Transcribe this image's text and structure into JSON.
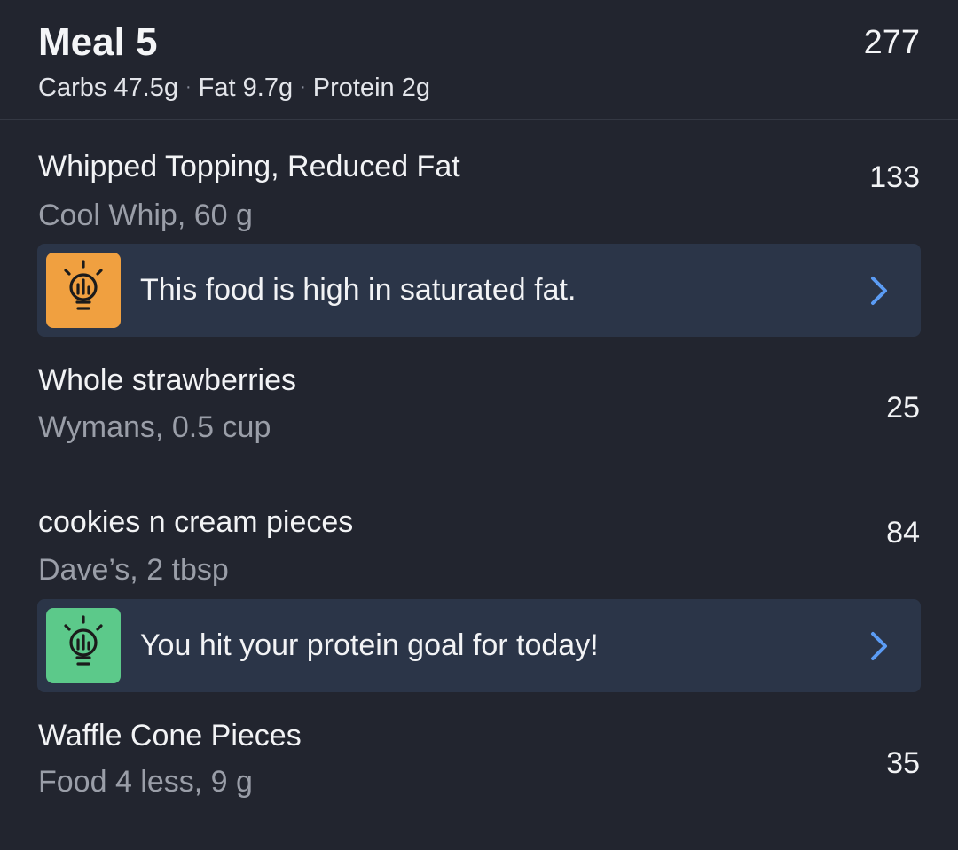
{
  "meal": {
    "title": "Meal 5",
    "calories": "277",
    "macros": {
      "carbs": "Carbs 47.5g",
      "fat": "Fat 9.7g",
      "protein": "Protein 2g",
      "separator": "·"
    }
  },
  "foods": [
    {
      "name": "Whipped Topping, Reduced Fat",
      "detail": "Cool Whip, 60 g",
      "calories": "133"
    },
    {
      "name": "Whole strawberries",
      "detail": "Wymans, 0.5 cup",
      "calories": "25"
    },
    {
      "name": "cookies n cream pieces",
      "detail": "Dave’s, 2 tbsp",
      "calories": "84"
    },
    {
      "name": "Waffle Cone Pieces",
      "detail": "Food 4 less, 9 g",
      "calories": "35"
    }
  ],
  "tips": [
    {
      "text": "This food is high in saturated fat.",
      "icon": "lightbulb-icon",
      "color": "#f0a040"
    },
    {
      "text": "You hit your protein goal for today!",
      "icon": "lightbulb-icon",
      "color": "#5cc98a"
    }
  ],
  "colors": {
    "background": "#22252f",
    "tip_background": "#2b3548",
    "chevron": "#5b9cf5"
  }
}
